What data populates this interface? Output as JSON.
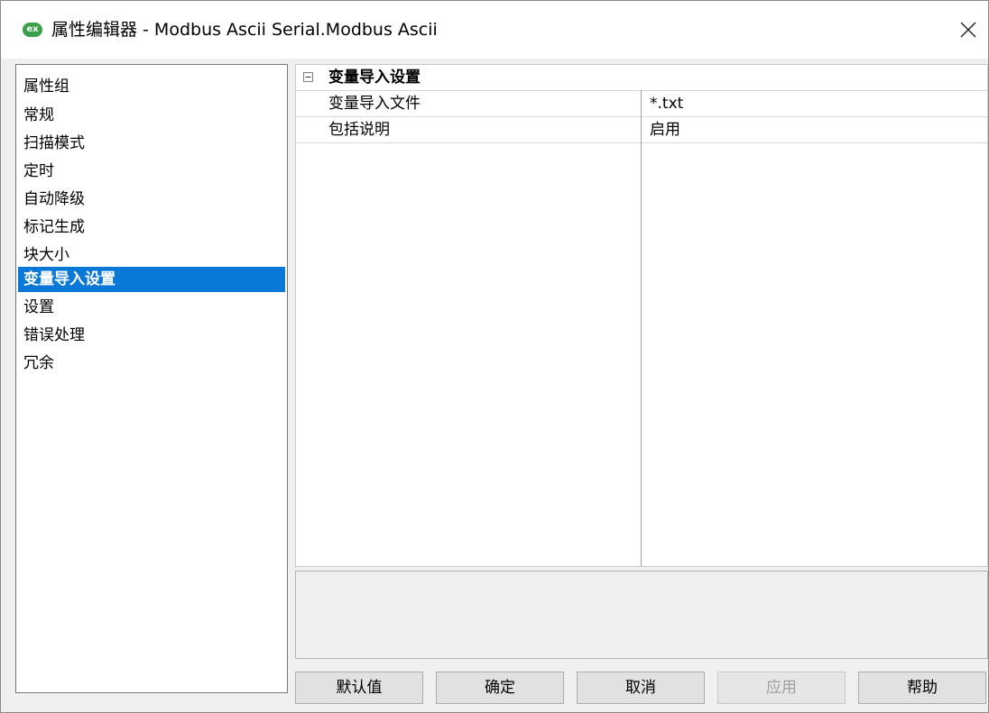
{
  "window": {
    "icon_text": "ex",
    "title": "属性编辑器 - Modbus Ascii Serial.Modbus Ascii",
    "close_glyph": "×"
  },
  "left_panel": {
    "header": "属性组",
    "items": [
      {
        "label": "常规"
      },
      {
        "label": "扫描模式"
      },
      {
        "label": "定时"
      },
      {
        "label": "自动降级"
      },
      {
        "label": "标记生成"
      },
      {
        "label": "块大小"
      },
      {
        "label": "变量导入设置",
        "selected": true
      },
      {
        "label": "设置"
      },
      {
        "label": "错误处理"
      },
      {
        "label": "冗余"
      }
    ]
  },
  "property_grid": {
    "category": {
      "label": "变量导入设置",
      "icon": "collapse-icon"
    },
    "rows": [
      {
        "name": "变量导入文件",
        "value": "*.txt"
      },
      {
        "name": "包括说明",
        "value": "启用"
      }
    ]
  },
  "buttons": {
    "default": "默认值",
    "ok": "确定",
    "cancel": "取消",
    "apply": "应用",
    "help": "帮助"
  }
}
